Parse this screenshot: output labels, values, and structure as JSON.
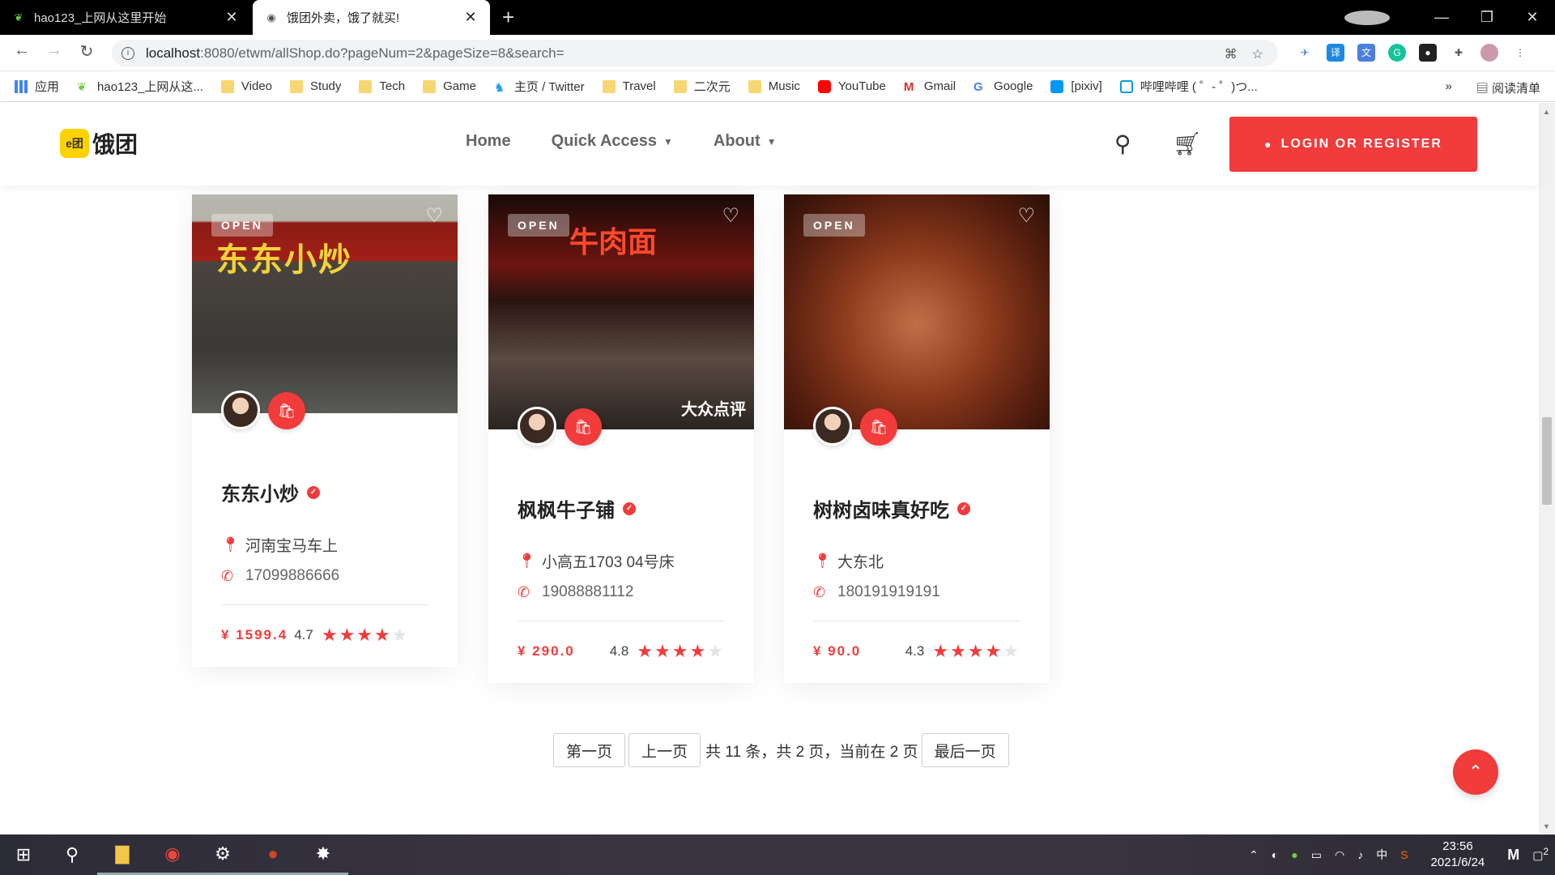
{
  "browser": {
    "tabs": [
      {
        "title": "hao123_上网从这里开始"
      },
      {
        "title": "饿团外卖，饿了就买!"
      }
    ],
    "url_host": "localhost",
    "url_path": ":8080/etwm/allShop.do?pageNum=2&pageSize=8&search=",
    "bookmarks": [
      {
        "label": "应用",
        "icon": "apps-grid-icon"
      },
      {
        "label": "hao123_上网从这...",
        "icon": "hao123-icon"
      },
      {
        "label": "Video",
        "icon": "folder-icon"
      },
      {
        "label": "Study",
        "icon": "folder-icon"
      },
      {
        "label": "Tech",
        "icon": "folder-icon"
      },
      {
        "label": "Game",
        "icon": "folder-icon"
      },
      {
        "label": "主页 / Twitter",
        "icon": "twitter-icon"
      },
      {
        "label": "Travel",
        "icon": "folder-icon"
      },
      {
        "label": "二次元",
        "icon": "folder-icon"
      },
      {
        "label": "Music",
        "icon": "folder-icon"
      },
      {
        "label": "YouTube",
        "icon": "youtube-icon"
      },
      {
        "label": "Gmail",
        "icon": "gmail-icon"
      },
      {
        "label": "Google",
        "icon": "google-icon"
      },
      {
        "label": "[pixiv]",
        "icon": "pixiv-icon"
      },
      {
        "label": "哔哩哔哩 ( ゜- ゜)つ...",
        "icon": "bilibili-icon"
      }
    ],
    "reading_list": "阅读清单",
    "more": "»"
  },
  "site": {
    "logo_badge": "e团",
    "logo_text": "饿团",
    "nav": [
      "Home",
      "Quick Access",
      "About"
    ],
    "login_label": "LOGIN OR REGISTER",
    "accent": "#f23b3b"
  },
  "shops": [
    {
      "status": "OPEN",
      "sign": "东东小炒",
      "name": "东东小炒",
      "address": "河南宝马车上",
      "phone": "17099886666",
      "price": "¥ 1599.4",
      "rating_text": "4.7",
      "rating": 4.7
    },
    {
      "status": "OPEN",
      "sign": "牛肉面",
      "watermark": "大众点评",
      "name": "枫枫牛子铺",
      "address": "小高五1703 04号床",
      "phone": "19088881112",
      "price": "¥ 290.0",
      "rating_text": "4.8",
      "rating": 4.8
    },
    {
      "status": "OPEN",
      "name": "树树卤味真好吃",
      "address": "大东北",
      "phone": "180191919191",
      "price": "¥ 90.0",
      "rating_text": "4.3",
      "rating": 4.3
    }
  ],
  "pagination": {
    "first": "第一页",
    "prev": "上一页",
    "info": "共 11 条，共 2 页，当前在 2 页",
    "last": "最后一页"
  },
  "taskbar": {
    "time": "23:56",
    "date": "2021/6/24",
    "ime": "中",
    "notifications": "2"
  }
}
